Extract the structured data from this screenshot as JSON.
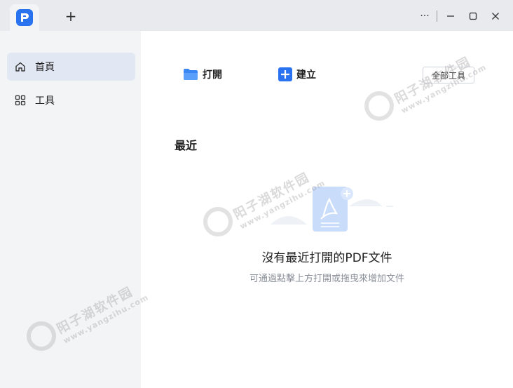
{
  "titlebar": {
    "new_tab_label": "+",
    "more_label": "···"
  },
  "sidebar": {
    "items": [
      {
        "label": "首頁",
        "icon": "home-icon",
        "active": true
      },
      {
        "label": "工具",
        "icon": "grid-icon",
        "active": false
      }
    ]
  },
  "main": {
    "actions": [
      {
        "label": "打開",
        "icon": "folder-icon"
      },
      {
        "label": "建立",
        "icon": "plus-square-icon"
      }
    ],
    "all_tools_label": "全部工具",
    "recent_title": "最近",
    "empty_title": "沒有最近打開的PDF文件",
    "empty_subtitle": "可通過點擊上方打開或拖曳來增加文件"
  },
  "watermark": {
    "text": "阳子湖软件园",
    "url": "www.yangzihu.com"
  },
  "colors": {
    "accent": "#2a73f0",
    "folder": "#3b86f5",
    "sidebar_active": "#e1e7f3"
  }
}
